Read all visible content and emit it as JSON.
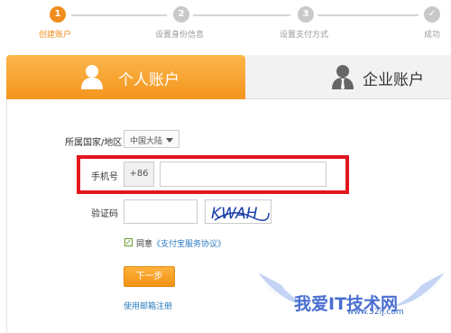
{
  "stepper": {
    "steps": [
      {
        "number": "1",
        "label": "创建账户"
      },
      {
        "number": "2",
        "label": "设置身份信息"
      },
      {
        "number": "3",
        "label": "设置支付方式"
      },
      {
        "number": "✓",
        "label": "成功"
      }
    ]
  },
  "tabs": {
    "personal_label": "个人账户",
    "enterprise_label": "企业账户"
  },
  "form": {
    "country_label": "所属国家/地区",
    "country_value": "中国大陆",
    "phone_label": "手机号",
    "phone_prefix": "+86",
    "phone_value": "",
    "captcha_label": "验证码",
    "captcha_value": "",
    "captcha_image_text": "KWAH",
    "agree_text": "同意",
    "agree_link": "《支付宝服务协议》",
    "next_button": "下一步",
    "email_register_link": "使用邮箱注册"
  },
  "watermark": {
    "text": "我爱IT技术网",
    "url": "www.52ij.com"
  },
  "colors": {
    "accent": "#f08c1e",
    "highlight": "#e3161e",
    "link": "#2a7bc1"
  }
}
